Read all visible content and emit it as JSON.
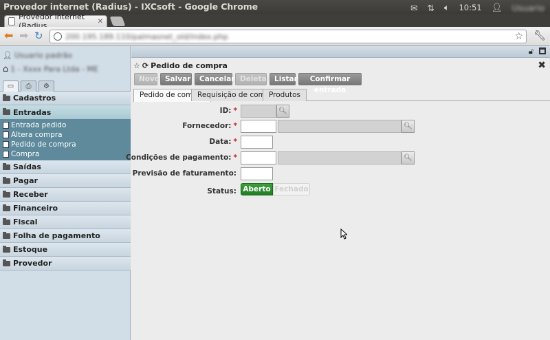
{
  "os": {
    "window_title": "Provedor internet (Radius) - IXCsoft - Google Chrome",
    "clock": "10:51",
    "user": "Usuario"
  },
  "browser": {
    "tab_title": "Provedor internet (Radius",
    "url": "200.195.189.110/palmasnet_old/index.php"
  },
  "sidebar": {
    "user": "Usuario padrão",
    "company": "1 - Xxxx Para Ltda - ME",
    "menu": [
      {
        "label": "Cadastros"
      },
      {
        "label": "Entradas",
        "open": true,
        "items": [
          "Entrada pedido",
          "Altera compra",
          "Pedido de compra",
          "Compra"
        ]
      },
      {
        "label": "Saídas"
      },
      {
        "label": "Pagar"
      },
      {
        "label": "Receber"
      },
      {
        "label": "Financeiro"
      },
      {
        "label": "Fiscal"
      },
      {
        "label": "Folha de pagamento"
      },
      {
        "label": "Estoque"
      },
      {
        "label": "Provedor"
      }
    ]
  },
  "panel": {
    "title": "Pedido de compra",
    "buttons": {
      "novo": "Novo",
      "salvar": "Salvar",
      "cancelar": "Cancelar",
      "deletar": "Deletar",
      "listar": "Listar",
      "confirmar": "Confirmar entrada"
    },
    "tabs": [
      "Pedido de compra",
      "Requisição de compra",
      "Produtos"
    ],
    "fields": {
      "id": "ID:",
      "fornecedor": "Fornecedor:",
      "data": "Data:",
      "condicoes": "Condições de pagamento:",
      "previsao": "Previsão de faturamento:",
      "status": "Status:"
    },
    "status": {
      "on": "Aberto",
      "off": "Fechado"
    }
  }
}
